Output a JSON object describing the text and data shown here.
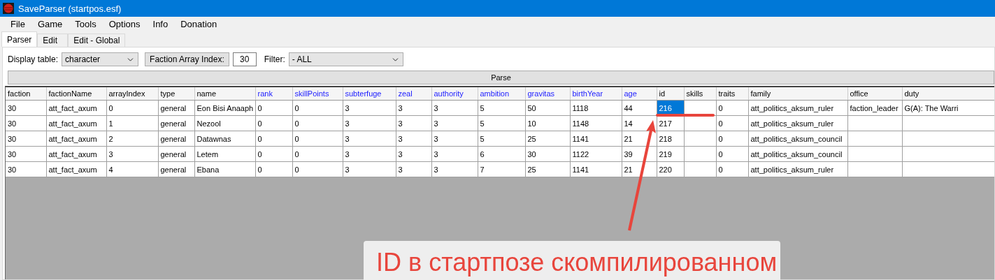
{
  "window": {
    "title": "SaveParser (startpos.esf)"
  },
  "menu": [
    "File",
    "Game",
    "Tools",
    "Options",
    "Info",
    "Donation"
  ],
  "tabs": [
    {
      "label": "Parser",
      "selected": true
    },
    {
      "label": "Edit",
      "selected": false
    },
    {
      "label": "Edit - Global",
      "selected": false
    }
  ],
  "toolbar": {
    "display_table_label": "Display table:",
    "display_table_value": "character",
    "faction_index_label": "Faction Array Index:",
    "faction_index_value": "30",
    "filter_label": "Filter:",
    "filter_value": "- ALL"
  },
  "parse_button": "Parse",
  "table": {
    "columns": [
      {
        "label": "faction",
        "kind": "plain"
      },
      {
        "label": "factionName",
        "kind": "plain"
      },
      {
        "label": "arrayIndex",
        "kind": "plain"
      },
      {
        "label": "type",
        "kind": "plain"
      },
      {
        "label": "name",
        "kind": "plain"
      },
      {
        "label": "rank",
        "kind": "editable"
      },
      {
        "label": "skillPoints",
        "kind": "editable"
      },
      {
        "label": "subterfuge",
        "kind": "editable"
      },
      {
        "label": "zeal",
        "kind": "editable"
      },
      {
        "label": "authority",
        "kind": "editable"
      },
      {
        "label": "ambition",
        "kind": "editable"
      },
      {
        "label": "gravitas",
        "kind": "editable"
      },
      {
        "label": "birthYear",
        "kind": "editable"
      },
      {
        "label": "age",
        "kind": "editable"
      },
      {
        "label": "id",
        "kind": "plain"
      },
      {
        "label": "skills",
        "kind": "plain"
      },
      {
        "label": "traits",
        "kind": "plain"
      },
      {
        "label": "family",
        "kind": "plain"
      },
      {
        "label": "office",
        "kind": "plain"
      },
      {
        "label": "duty",
        "kind": "plain"
      }
    ],
    "rows": [
      {
        "cells": [
          {
            "text": "30",
            "selected": false
          },
          {
            "text": "att_fact_axum",
            "selected": false
          },
          {
            "text": "0",
            "selected": false
          },
          {
            "text": "general",
            "selected": false
          },
          {
            "text": "Eon Bisi Anaaph",
            "selected": false
          },
          {
            "text": "0",
            "selected": false
          },
          {
            "text": "0",
            "selected": false
          },
          {
            "text": "3",
            "selected": false
          },
          {
            "text": "3",
            "selected": false
          },
          {
            "text": "3",
            "selected": false
          },
          {
            "text": "5",
            "selected": false
          },
          {
            "text": "50",
            "selected": false
          },
          {
            "text": "1118",
            "selected": false
          },
          {
            "text": "44",
            "selected": false
          },
          {
            "text": "216",
            "selected": true
          },
          {
            "selected": false
          },
          {
            "text": "0",
            "selected": false
          },
          {
            "text": "att_politics_aksum_ruler",
            "selected": false
          },
          {
            "text": "faction_leader",
            "selected": false
          },
          {
            "text": "G(A): The Warri",
            "selected": false
          }
        ]
      },
      {
        "cells": [
          {
            "text": "30",
            "selected": false
          },
          {
            "text": "att_fact_axum",
            "selected": false
          },
          {
            "text": "1",
            "selected": false
          },
          {
            "text": "general",
            "selected": false
          },
          {
            "text": "Nezool",
            "selected": false
          },
          {
            "text": "0",
            "selected": false
          },
          {
            "text": "0",
            "selected": false
          },
          {
            "text": "3",
            "selected": false
          },
          {
            "text": "3",
            "selected": false
          },
          {
            "text": "3",
            "selected": false
          },
          {
            "text": "5",
            "selected": false
          },
          {
            "text": "10",
            "selected": false
          },
          {
            "text": "1148",
            "selected": false
          },
          {
            "text": "14",
            "selected": false
          },
          {
            "text": "217",
            "selected": false
          },
          {
            "selected": false
          },
          {
            "text": "0",
            "selected": false
          },
          {
            "text": "att_politics_aksum_ruler",
            "selected": false
          },
          {
            "selected": false
          },
          {
            "selected": false
          }
        ]
      },
      {
        "cells": [
          {
            "text": "30",
            "selected": false
          },
          {
            "text": "att_fact_axum",
            "selected": false
          },
          {
            "text": "2",
            "selected": false
          },
          {
            "text": "general",
            "selected": false
          },
          {
            "text": "Datawnas",
            "selected": false
          },
          {
            "text": "0",
            "selected": false
          },
          {
            "text": "0",
            "selected": false
          },
          {
            "text": "3",
            "selected": false
          },
          {
            "text": "3",
            "selected": false
          },
          {
            "text": "3",
            "selected": false
          },
          {
            "text": "5",
            "selected": false
          },
          {
            "text": "25",
            "selected": false
          },
          {
            "text": "1141",
            "selected": false
          },
          {
            "text": "21",
            "selected": false
          },
          {
            "text": "218",
            "selected": false
          },
          {
            "selected": false
          },
          {
            "text": "0",
            "selected": false
          },
          {
            "text": "att_politics_aksum_council",
            "selected": false
          },
          {
            "selected": false
          },
          {
            "selected": false
          }
        ]
      },
      {
        "cells": [
          {
            "text": "30",
            "selected": false
          },
          {
            "text": "att_fact_axum",
            "selected": false
          },
          {
            "text": "3",
            "selected": false
          },
          {
            "text": "general",
            "selected": false
          },
          {
            "text": "Letem",
            "selected": false
          },
          {
            "text": "0",
            "selected": false
          },
          {
            "text": "0",
            "selected": false
          },
          {
            "text": "3",
            "selected": false
          },
          {
            "text": "3",
            "selected": false
          },
          {
            "text": "3",
            "selected": false
          },
          {
            "text": "6",
            "selected": false
          },
          {
            "text": "30",
            "selected": false
          },
          {
            "text": "1122",
            "selected": false
          },
          {
            "text": "39",
            "selected": false
          },
          {
            "text": "219",
            "selected": false
          },
          {
            "selected": false
          },
          {
            "text": "0",
            "selected": false
          },
          {
            "text": "att_politics_aksum_council",
            "selected": false
          },
          {
            "selected": false
          },
          {
            "selected": false
          }
        ]
      },
      {
        "cells": [
          {
            "text": "30",
            "selected": false
          },
          {
            "text": "att_fact_axum",
            "selected": false
          },
          {
            "text": "4",
            "selected": false
          },
          {
            "text": "general",
            "selected": false
          },
          {
            "text": "Ebana",
            "selected": false
          },
          {
            "text": "0",
            "selected": false
          },
          {
            "text": "0",
            "selected": false
          },
          {
            "text": "3",
            "selected": false
          },
          {
            "text": "3",
            "selected": false
          },
          {
            "text": "3",
            "selected": false
          },
          {
            "text": "7",
            "selected": false
          },
          {
            "text": "25",
            "selected": false
          },
          {
            "text": "1141",
            "selected": false
          },
          {
            "text": "21",
            "selected": false
          },
          {
            "text": "220",
            "selected": false
          },
          {
            "selected": false
          },
          {
            "text": "0",
            "selected": false
          },
          {
            "text": "att_politics_aksum_ruler",
            "selected": false
          },
          {
            "selected": false
          },
          {
            "selected": false
          }
        ]
      }
    ]
  },
  "annotation": {
    "label": "ID в стартпозе скомпилированном"
  }
}
